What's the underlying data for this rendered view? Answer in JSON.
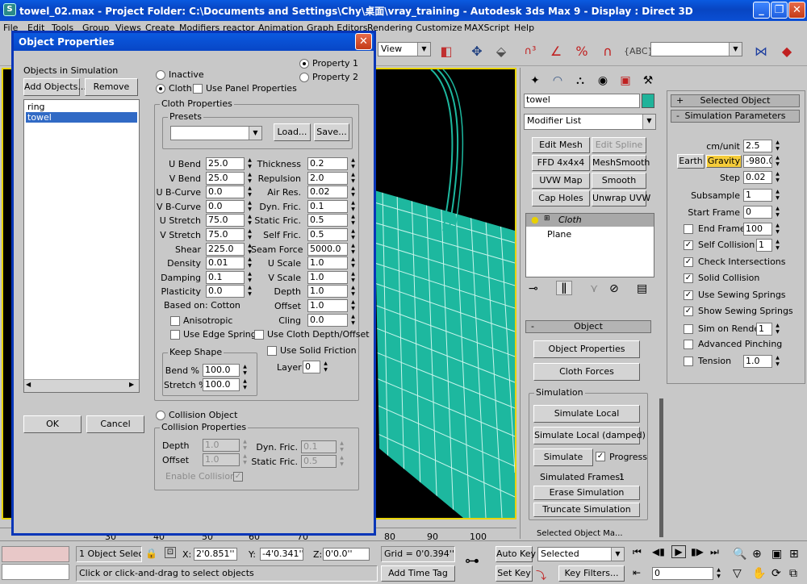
{
  "window": {
    "title": "towel_02.max     - Project Folder: C:\\Documents and Settings\\Chy\\桌面\\vray_training     - Autodesk 3ds Max 9     - Display : Direct 3D",
    "icon_text": "S"
  },
  "menu": [
    "File",
    "Edit",
    "Tools",
    "Group",
    "Views",
    "Create",
    "Modifiers",
    "reactor",
    "Animation",
    "Graph Editors",
    "Rendering",
    "Customize",
    "MAXScript",
    "Help"
  ],
  "toolbar": {
    "view_dropdown": "View",
    "named_selection": ""
  },
  "ruler_ticks": [
    "30",
    "40",
    "50",
    "60",
    "70",
    "80",
    "90",
    "100"
  ],
  "command_panel": {
    "object_name": "towel",
    "object_color": "#1fb39a",
    "modifier_list": "Modifier List",
    "modifier_buttons": [
      "Edit Mesh",
      "Edit Spline",
      "FFD 4x4x4",
      "MeshSmooth",
      "UVW Map",
      "Smooth",
      "Cap Holes",
      "Unwrap UVW"
    ],
    "stack": [
      "Cloth",
      "Plane"
    ],
    "object_rollout": "Object",
    "object_properties_button": "Object Properties",
    "cloth_forces_button": "Cloth Forces",
    "simulation_group": "Simulation",
    "simulate_local": "Simulate Local",
    "simulate_local_damped": "Simulate Local (damped)",
    "simulate": "Simulate",
    "progress": "Progress",
    "simulated_frames_label": "Simulated Frames:",
    "simulated_frames_value": "1",
    "erase_simulation": "Erase Simulation",
    "truncate_simulation": "Truncate Simulation",
    "bottom_cut": "Selected Object Ma..."
  },
  "right_panel": {
    "selected_object": "Selected Object",
    "simulation_parameters": "Simulation Parameters",
    "cm_unit_label": "cm/unit",
    "cm_unit": "2.5",
    "earth": "Earth",
    "gravity": "Gravity",
    "gravity_value": "-980.0",
    "step_label": "Step",
    "step": "0.02",
    "subsample_label": "Subsample",
    "subsample": "1",
    "start_frame_label": "Start Frame",
    "start_frame": "0",
    "end_frame_label": "End Frame",
    "end_frame": "100",
    "self_collision_label": "Self Collision",
    "self_collision": "1",
    "check_intersections": "Check Intersections",
    "solid_collision": "Solid Collision",
    "use_sewing_springs": "Use Sewing Springs",
    "show_sewing_springs": "Show Sewing Springs",
    "sim_on_render_label": "Sim on Render",
    "sim_on_render": "1",
    "advanced_pinching": "Advanced Pinching",
    "tension_label": "Tension",
    "tension": "1.0"
  },
  "dialog": {
    "title": "Object Properties",
    "objects_in_simulation": "Objects in Simulation",
    "add_objects": "Add Objects...",
    "remove": "Remove",
    "objects": [
      "ring",
      "towel"
    ],
    "ok": "OK",
    "cancel": "Cancel",
    "inactive": "Inactive",
    "cloth": "Cloth",
    "use_panel_properties": "Use Panel Properties",
    "property1": "Property 1",
    "property2": "Property 2",
    "cloth_properties": "Cloth Properties",
    "presets": "Presets",
    "load": "Load...",
    "save": "Save...",
    "left_params": [
      {
        "label": "U Bend",
        "value": "25.0"
      },
      {
        "label": "V Bend",
        "value": "25.0"
      },
      {
        "label": "U B-Curve",
        "value": "0.0"
      },
      {
        "label": "V B-Curve",
        "value": "0.0"
      },
      {
        "label": "U Stretch",
        "value": "75.0"
      },
      {
        "label": "V Stretch",
        "value": "75.0"
      },
      {
        "label": "Shear",
        "value": "225.0"
      },
      {
        "label": "Density",
        "value": "0.01"
      },
      {
        "label": "Damping",
        "value": "0.1"
      },
      {
        "label": "Plasticity",
        "value": "0.0"
      }
    ],
    "right_params": [
      {
        "label": "Thickness",
        "value": "0.2"
      },
      {
        "label": "Repulsion",
        "value": "2.0"
      },
      {
        "label": "Air Res.",
        "value": "0.02"
      },
      {
        "label": "Dyn. Fric.",
        "value": "0.1"
      },
      {
        "label": "Static Fric.",
        "value": "0.5"
      },
      {
        "label": "Self Fric.",
        "value": "0.5"
      },
      {
        "label": "Seam Force",
        "value": "5000.0"
      },
      {
        "label": "U Scale",
        "value": "1.0"
      },
      {
        "label": "V Scale",
        "value": "1.0"
      },
      {
        "label": "Depth",
        "value": "1.0"
      },
      {
        "label": "Offset",
        "value": "1.0"
      },
      {
        "label": "Cling",
        "value": "0.0"
      }
    ],
    "based_on": "Based on: Cotton",
    "anisotropic": "Anisotropic",
    "use_edge_springs": "Use Edge Springs",
    "use_cloth_depth_offset": "Use Cloth Depth/Offset",
    "use_solid_friction": "Use Solid Friction",
    "keep_shape": "Keep Shape",
    "bend_label": "Bend %",
    "bend": "100.0",
    "stretch_label": "Stretch %",
    "stretch": "100.0",
    "layer_label": "Layer",
    "layer": "0",
    "collision_object": "Collision Object",
    "collision_properties": "Collision Properties",
    "col_depth_label": "Depth",
    "col_depth": "1.0",
    "col_offset_label": "Offset",
    "col_offset": "1.0",
    "col_dyn_fric_label": "Dyn. Fric.",
    "col_dyn_fric": "0.1",
    "col_static_fric_label": "Static Fric.",
    "col_static_fric": "0.5",
    "enable_collisions": "Enable Collisions"
  },
  "status": {
    "selected_count": "1 Object Selecte",
    "x_label": "X:",
    "x_value": "2'0.851''",
    "y_label": "Y:",
    "y_value": "-4'0.341''",
    "z_label": "Z:",
    "z_value": "0'0.0''",
    "grid": "Grid = 0'0.394''",
    "add_time_tag": "Add Time Tag",
    "prompt": "Click or click-and-drag to select objects",
    "auto_key": "Auto Key",
    "set_key": "Set Key",
    "key_mode": "Selected",
    "key_filters": "Key Filters...",
    "frame": "0"
  }
}
